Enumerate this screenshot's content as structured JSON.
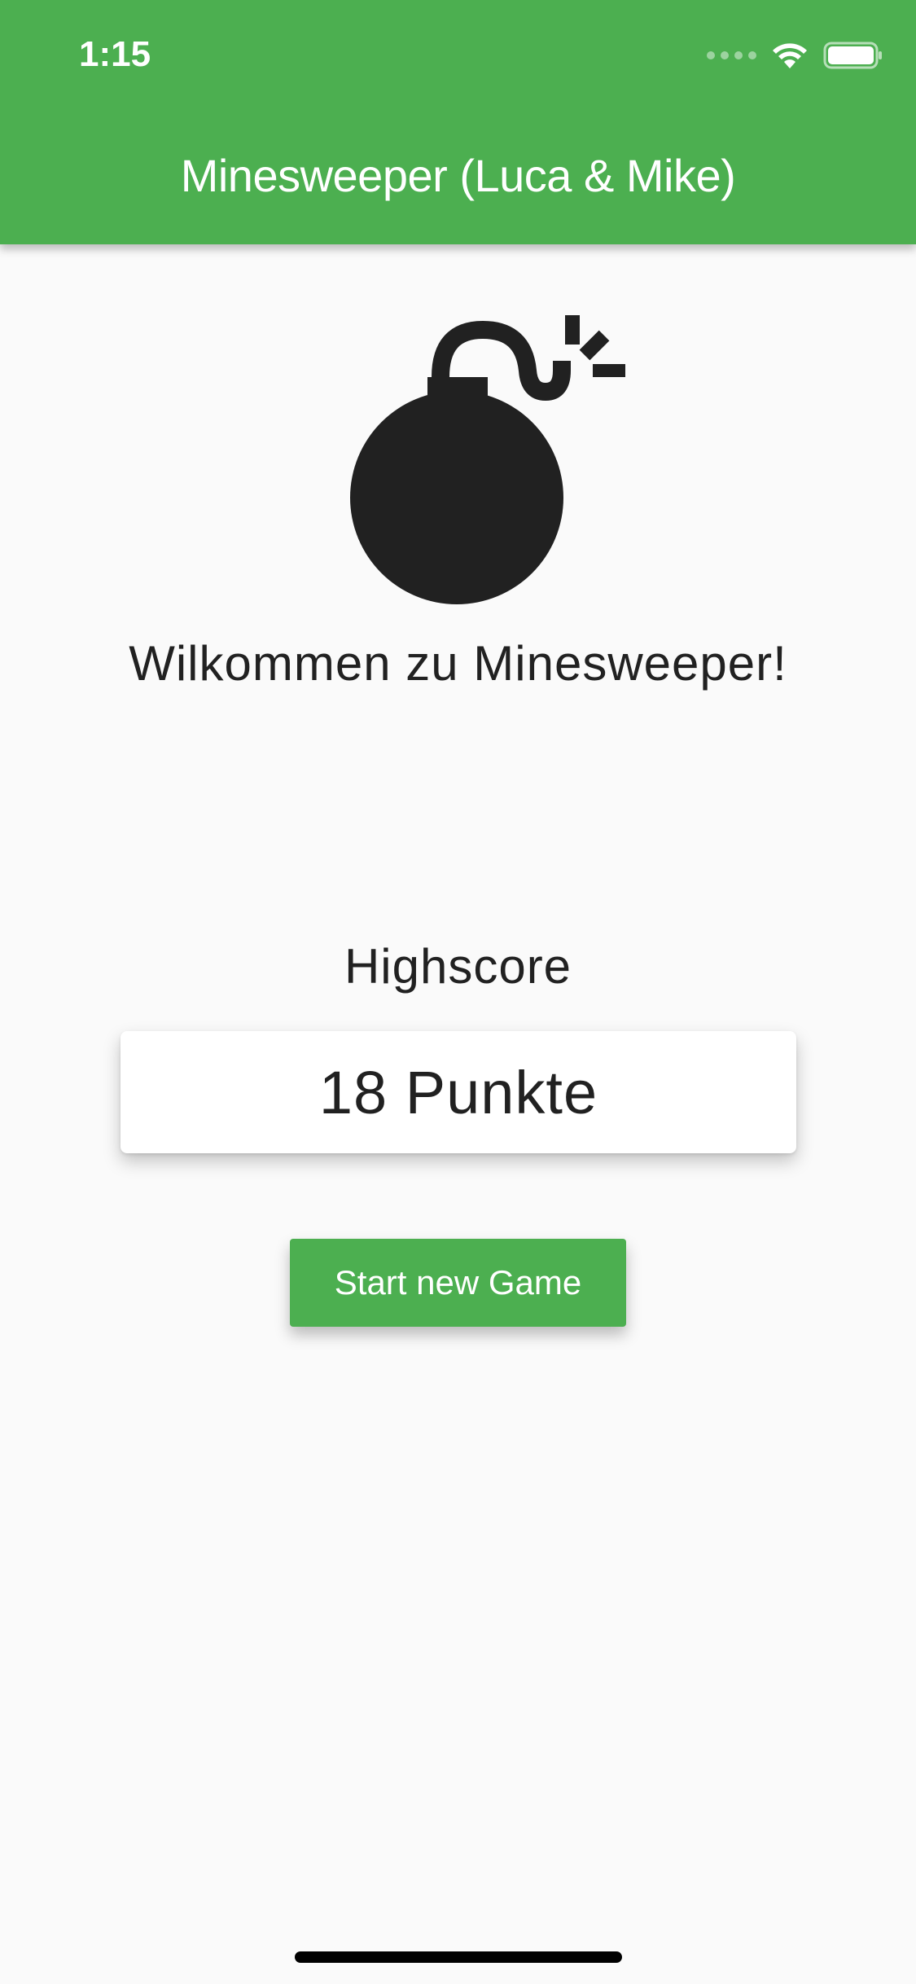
{
  "status_bar": {
    "time": "1:15",
    "wifi_icon": "wifi-icon",
    "battery_icon": "battery-icon",
    "signal_icon": "cellular-signal-icon"
  },
  "app_bar": {
    "title": "Minesweeper (Luca & Mike)",
    "color": "#4caf50"
  },
  "main": {
    "hero_icon": "bomb-icon",
    "welcome": "Wilkommen zu Minesweeper!",
    "highscore_label": "Highscore",
    "highscore_value": "18 Punkte",
    "start_button_label": "Start new Game"
  },
  "colors": {
    "accent": "#4caf50",
    "background": "#fafafa",
    "text": "#212121"
  }
}
